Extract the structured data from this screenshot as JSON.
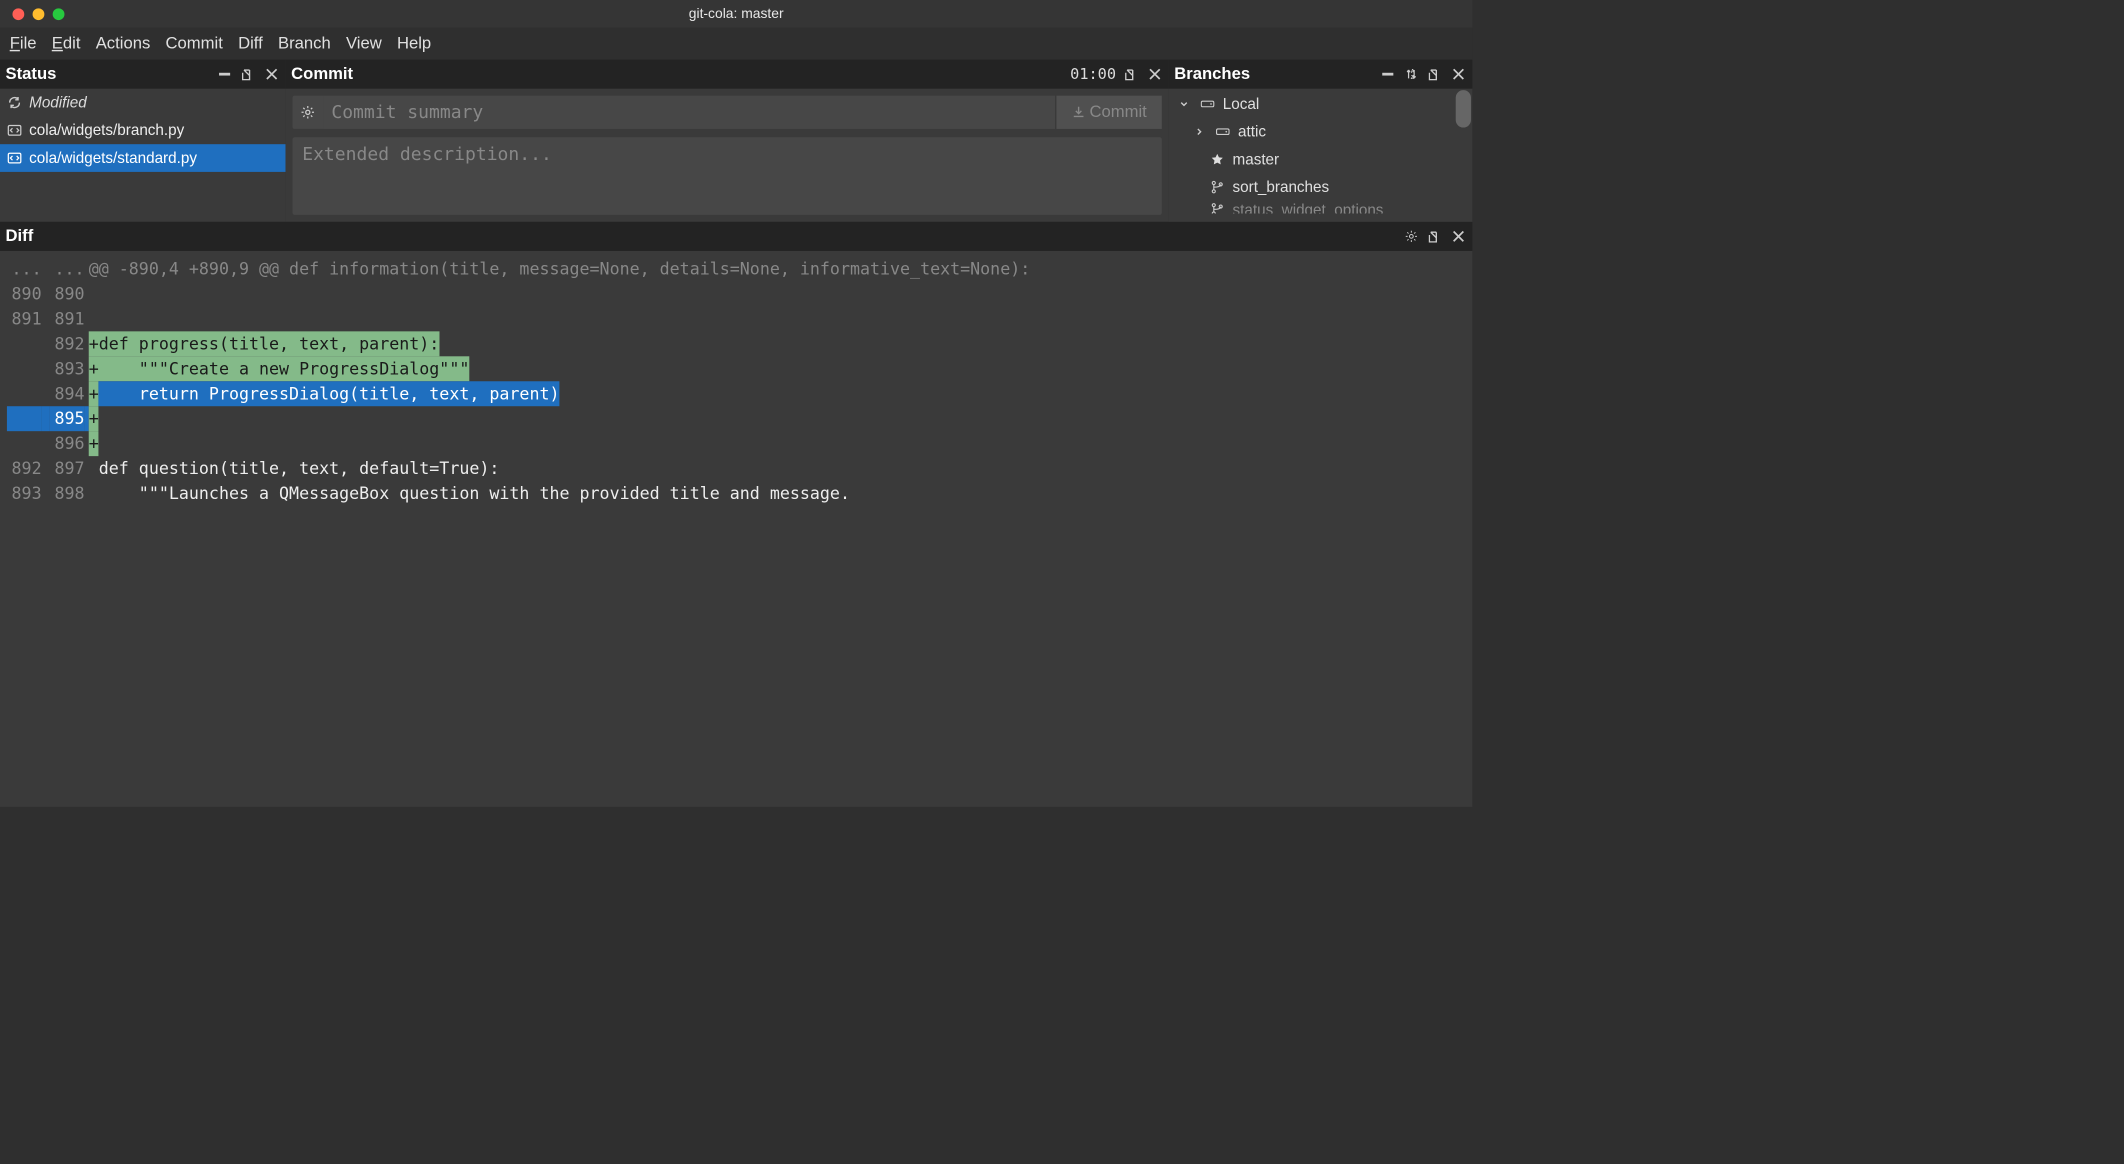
{
  "window": {
    "title": "git-cola: master"
  },
  "menus": {
    "file": "File",
    "edit": "Edit",
    "actions": "Actions",
    "commit": "Commit",
    "diff": "Diff",
    "branch": "Branch",
    "view": "View",
    "help": "Help"
  },
  "status": {
    "title": "Status",
    "modified_label": "Modified",
    "files": [
      "cola/widgets/branch.py",
      "cola/widgets/standard.py"
    ],
    "selected_index": 1
  },
  "commit": {
    "title": "Commit",
    "countdown": "01:00",
    "summary_placeholder": "Commit summary",
    "description_placeholder": "Extended description...",
    "button_label": "Commit"
  },
  "branches": {
    "title": "Branches",
    "local_label": "Local",
    "items": [
      {
        "name": "attic",
        "type": "folder"
      },
      {
        "name": "master",
        "type": "starred"
      },
      {
        "name": "sort_branches",
        "type": "branch"
      },
      {
        "name": "status_widget_options",
        "type": "branch"
      }
    ]
  },
  "diff": {
    "title": "Diff",
    "hunk_header": "@@ -890,4 +890,9 @@ def information(title, message=None, details=None, informative_text=None):",
    "lines": [
      {
        "old": "...",
        "new": "...",
        "type": "hunk"
      },
      {
        "old": "890",
        "new": "890",
        "type": "ctx",
        "text": ""
      },
      {
        "old": "891",
        "new": "891",
        "type": "ctx",
        "text": ""
      },
      {
        "old": "",
        "new": "892",
        "type": "add_hl",
        "text": "+def progress(title, text, parent):"
      },
      {
        "old": "",
        "new": "893",
        "type": "add_hl",
        "text": "+    \"\"\"Create a new ProgressDialog\"\"\""
      },
      {
        "old": "",
        "new": "894",
        "type": "add_sel",
        "text": "+    return ProgressDialog(title, text, parent)"
      },
      {
        "old": "",
        "new": "895",
        "type": "add_sel_empty",
        "text": "+"
      },
      {
        "old": "",
        "new": "896",
        "type": "add_plain",
        "text": "+"
      },
      {
        "old": "892",
        "new": "897",
        "type": "ctx",
        "text": " def question(title, text, default=True):"
      },
      {
        "old": "893",
        "new": "898",
        "type": "ctx",
        "text": "     \"\"\"Launches a QMessageBox question with the provided title and message."
      }
    ]
  }
}
